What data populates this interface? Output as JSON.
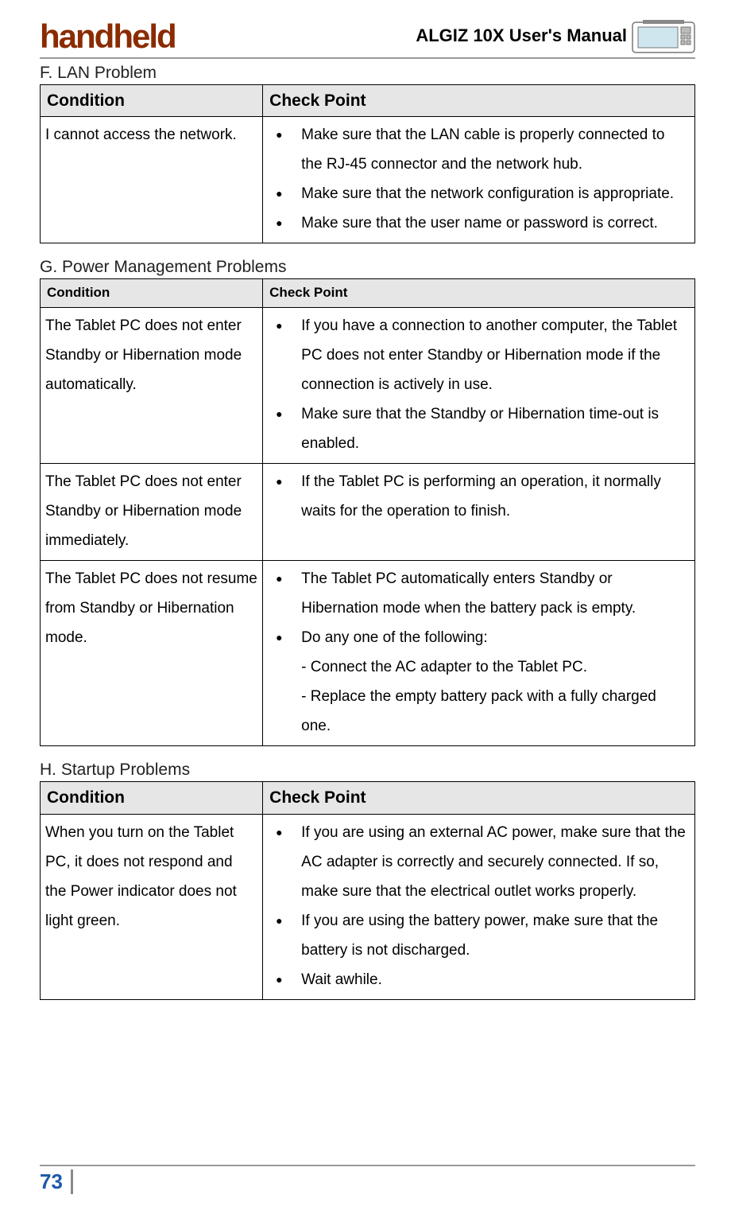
{
  "header": {
    "logo_text": "handheld",
    "manual_title": "ALGIZ 10X User's Manual"
  },
  "sections": [
    {
      "heading": "F. LAN Problem",
      "header_size": "big",
      "cols": {
        "condition": "Condition",
        "checkpoint": "Check Point"
      },
      "rows": [
        {
          "condition": "I cannot access the network.",
          "points": [
            {
              "text": "Make sure that the LAN cable is properly connected to the RJ-45 connector and the network hub."
            },
            {
              "text": "Make sure that the network configuration is appropriate."
            },
            {
              "text": "Make sure that the user name or password is correct."
            }
          ]
        }
      ]
    },
    {
      "heading": "G. Power Management Problems",
      "header_size": "small",
      "cols": {
        "condition": "Condition",
        "checkpoint": "Check Point"
      },
      "rows": [
        {
          "condition": "The Tablet PC does not enter Standby or Hibernation mode automatically.",
          "points": [
            {
              "text": "If you have a connection to another computer, the Tablet PC does not enter Standby or Hibernation mode if the connection is actively in use."
            },
            {
              "text": "Make sure that the Standby or Hibernation time-out is enabled."
            }
          ]
        },
        {
          "condition": "The Tablet PC does not enter Standby or Hibernation mode immediately.",
          "points": [
            {
              "text": "If the Tablet PC is performing an operation, it normally waits for the operation to finish."
            }
          ]
        },
        {
          "condition": "The Tablet PC does not resume from Standby or Hibernation mode.",
          "points": [
            {
              "text": "The Tablet PC automatically enters Standby or Hibernation mode when the battery pack is empty."
            },
            {
              "text": "Do any one of the following:",
              "subs": [
                "- Connect the AC adapter to the Tablet PC.",
                "- Replace the empty battery pack with a fully charged one."
              ]
            }
          ]
        }
      ]
    },
    {
      "heading": "H. Startup Problems",
      "header_size": "big",
      "cols": {
        "condition": "Condition",
        "checkpoint": "Check Point"
      },
      "rows": [
        {
          "condition": "When you turn on the Tablet PC, it does not respond and the Power indicator does not light green.",
          "points": [
            {
              "text": "If you are using an external AC power, make sure that the AC adapter is correctly and securely connected. If so, make sure that the electrical outlet works properly."
            },
            {
              "text": "If you are using the battery power, make sure that the battery is not discharged."
            },
            {
              "text": "Wait awhile."
            }
          ]
        }
      ]
    }
  ],
  "footer": {
    "page_number": "73"
  }
}
